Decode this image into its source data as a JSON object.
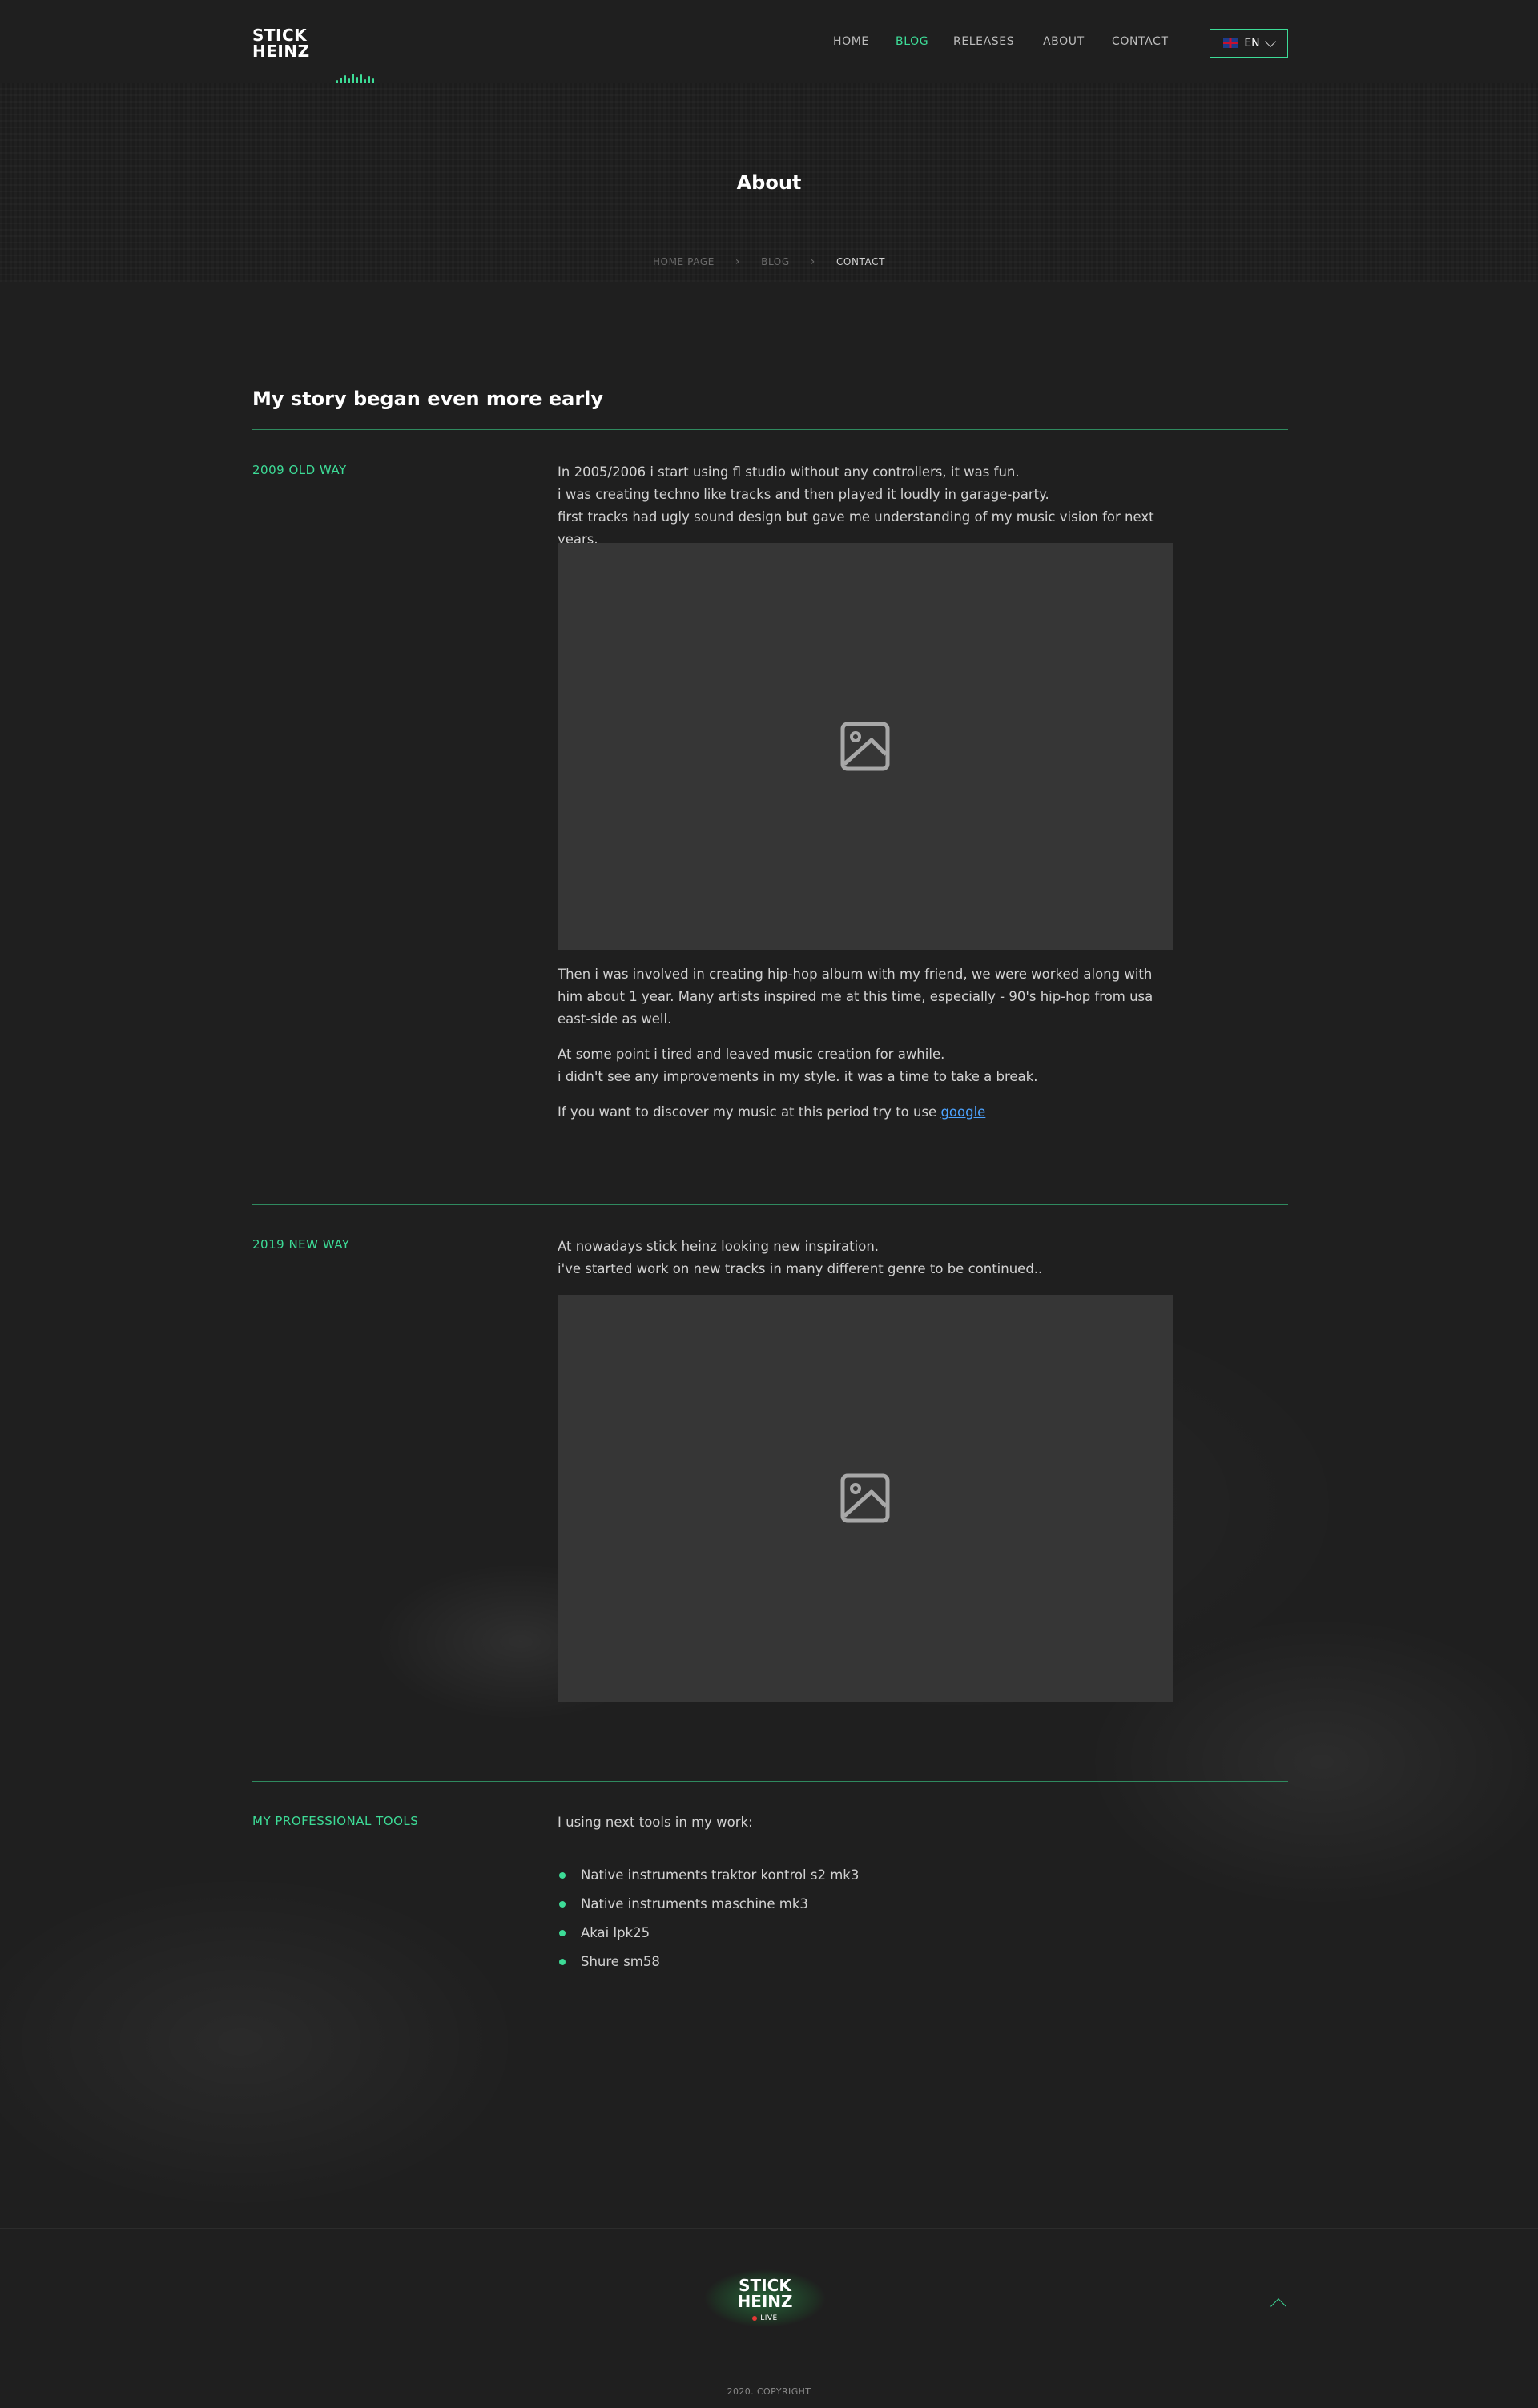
{
  "header": {
    "logo_line1": "STICK",
    "logo_line2": "HEINZ",
    "nav": [
      {
        "label": "HOME",
        "active": false
      },
      {
        "label": "BLOG",
        "active": true
      },
      {
        "label": "RELEASES",
        "active": false
      },
      {
        "label": "ABOUT",
        "active": false
      },
      {
        "label": "CONTACT",
        "active": false
      }
    ],
    "language": "EN",
    "accent_color": "#3ddc97"
  },
  "hero": {
    "title": "About",
    "breadcrumbs": [
      "HOME PAGE",
      "BLOG",
      "CONTACT"
    ]
  },
  "story": {
    "title": "My story began even more early",
    "sections": [
      {
        "label": "2009 OLD WAY",
        "intro": [
          "In 2005/2006 i start using fl studio without any controllers, it was fun.",
          "i was creating techno like tracks and then played it loudly in garage-party.",
          "first tracks had ugly sound design but gave me understanding of my music vision for next years."
        ],
        "image_icon": "image-placeholder-icon",
        "paragraphs": [
          "Then i was involved in creating hip-hop album with my friend, we were worked along with him about 1 year. Many artists inspired me at this time, especially - 90's hip-hop from usa east-side as well.",
          "At some point i tired and leaved music creation for awhile.",
          "i didn't see any improvements in my style. it was a time to take a break."
        ],
        "discover_text": "If you want to discover my music at this period try to use ",
        "discover_link": "google"
      },
      {
        "label": "2019 NEW WAY",
        "intro": [
          "At nowadays stick heinz looking new inspiration.",
          "i've started work on new tracks in many different genre to be continued.."
        ],
        "image_icon": "image-placeholder-icon"
      }
    ],
    "tools": {
      "label": "MY PROFESSIONAL TOOLS",
      "intro": "I using next tools in my work:",
      "items": [
        "Native instruments traktor kontrol s2 mk3",
        "Native instruments maschine mk3",
        "Akai lpk25",
        "Shure sm58"
      ]
    }
  },
  "footer": {
    "logo_line1": "STICK",
    "logo_line2": "HEINZ",
    "live_label": "LIVE",
    "copyright": "2020. COPYRIGHT"
  }
}
